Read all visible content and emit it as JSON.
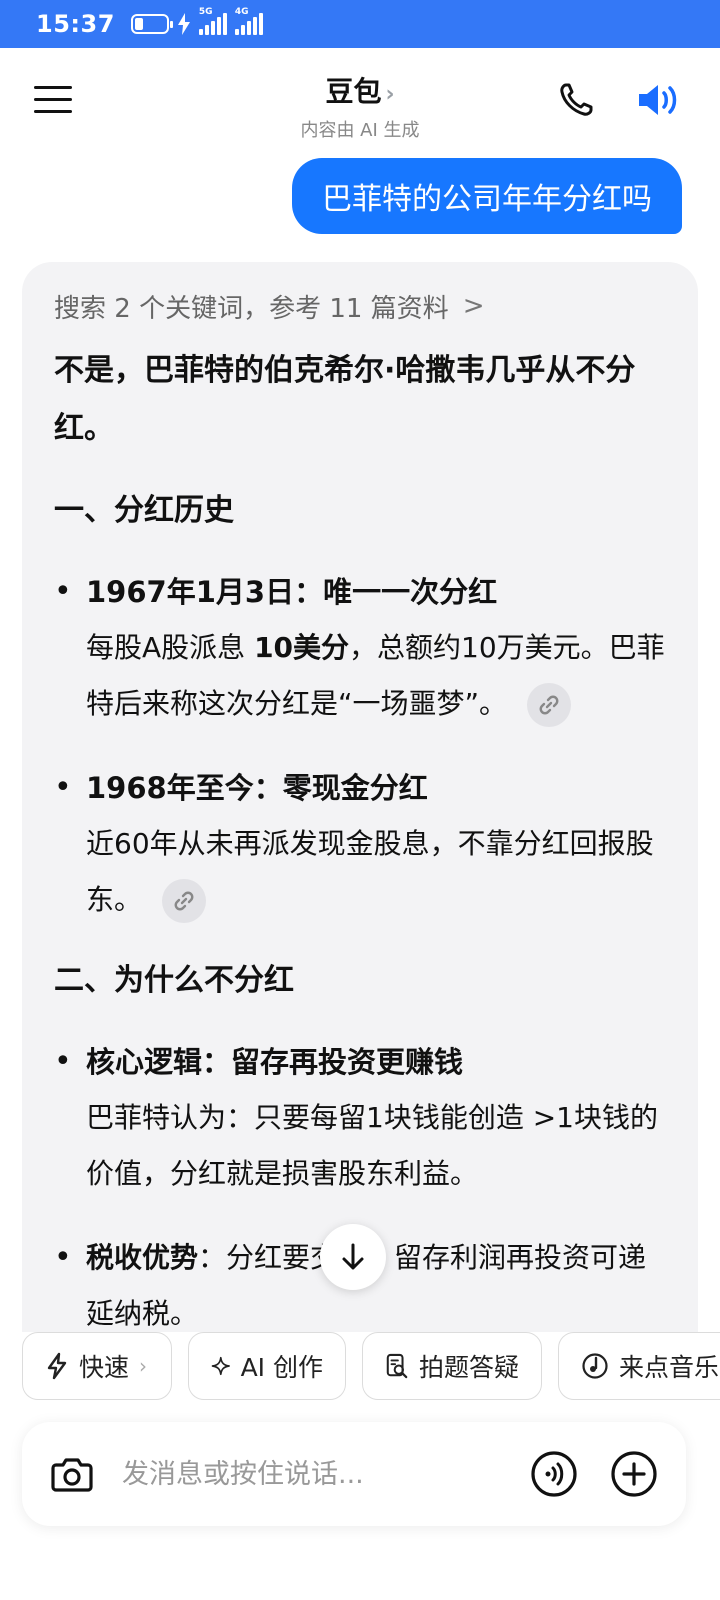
{
  "status_bar": {
    "time": "15:37",
    "net_5g": "5G",
    "net_4g": "4G"
  },
  "header": {
    "title": "豆包",
    "title_chevron": "›",
    "subtitle": "内容由 AI 生成"
  },
  "user_message": "巴菲特的公司年年分红吗",
  "answer": {
    "search_line": "搜索 2 个关键词，参考 11 篇资料",
    "search_arrow": ">",
    "headline": "不是，巴菲特的伯克希尔·哈撒韦几乎从不分红。",
    "sections": [
      {
        "title": "一、分红历史",
        "bullets": [
          {
            "title": "1967年1月3日：唯一一次分红",
            "body_pre": "每股A股派息 ",
            "body_bold": "10美分",
            "body_post": "，总额约10万美元。巴菲特后来称这次分红是“一场噩梦”。"
          },
          {
            "title": "1968年至今：零现金分红",
            "body": "近60年从未再派发现金股息，不靠分红回报股东。"
          }
        ]
      },
      {
        "title": "二、为什么不分红",
        "bullets": [
          {
            "title": "核心逻辑：留存再投资更赚钱",
            "body": "巴菲特认为：只要每留1块钱能创造 >1块钱的价值，分红就是损害股东利益。"
          },
          {
            "title": "税收优势",
            "body": "：分红要交税；留存利润再投资可递延纳税。"
          }
        ]
      }
    ],
    "bullet_glyph": "•"
  },
  "quick_chips": [
    {
      "label": "快速",
      "chevron": "›"
    },
    {
      "label": "AI 创作"
    },
    {
      "label": "拍题答疑"
    },
    {
      "label": "来点音乐"
    }
  ],
  "input": {
    "placeholder": "发消息或按住说话..."
  },
  "colors": {
    "status_bar": "#3478f6",
    "user_bubble": "#1777ff",
    "speaker_icon": "#1a6dff",
    "card_bg": "#f3f3f5"
  }
}
